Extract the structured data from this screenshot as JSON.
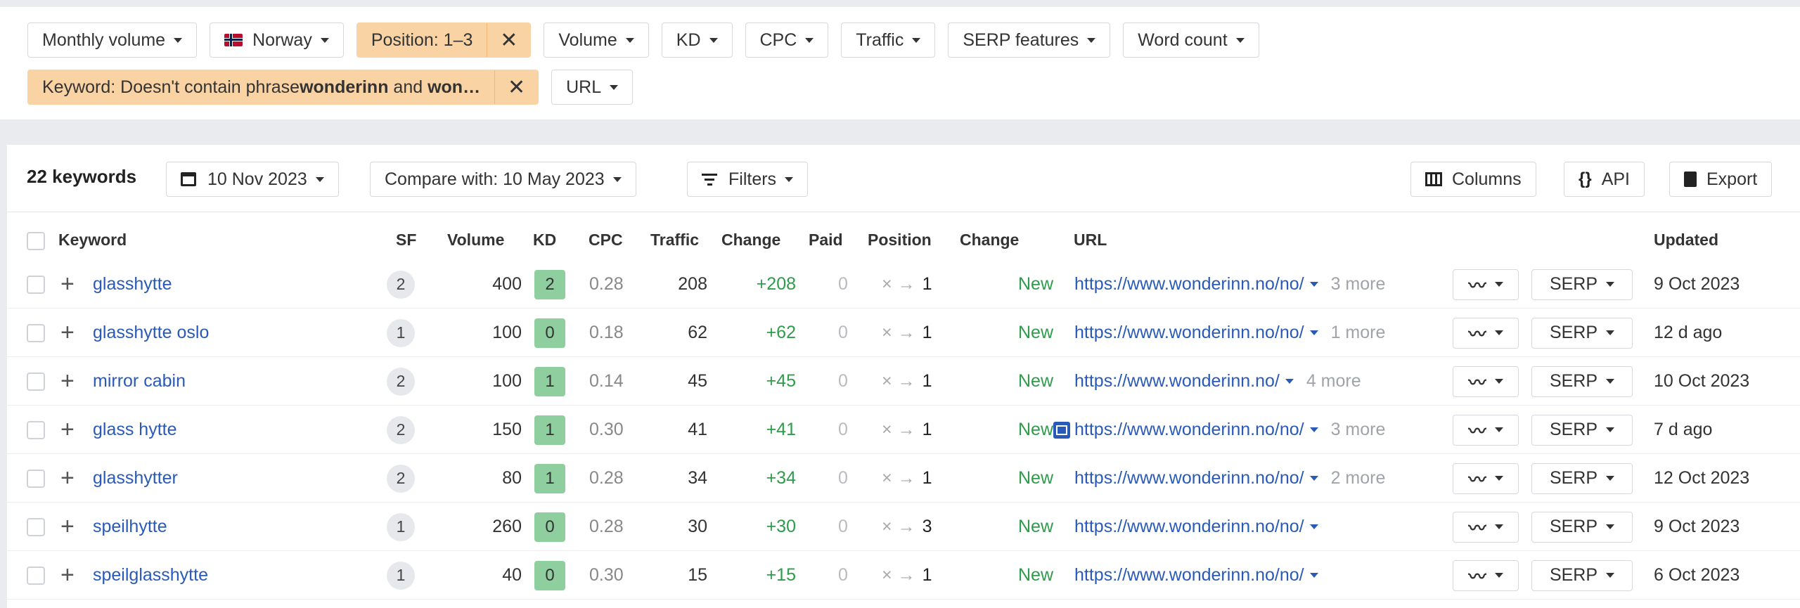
{
  "filters": {
    "row1": [
      {
        "label": "Monthly volume"
      },
      {
        "label": "Norway",
        "flag": "norway-flag"
      },
      {
        "label": "Position: 1–3",
        "active": true
      },
      {
        "label": "Volume"
      },
      {
        "label": "KD"
      },
      {
        "label": "CPC"
      },
      {
        "label": "Traffic"
      },
      {
        "label": "SERP features"
      },
      {
        "label": "Word count"
      }
    ],
    "keyword_filter": {
      "prefix": "Keyword: Doesn't contain phrase ",
      "bold1": "wonderinn",
      "mid": " and ",
      "bold2": "won…"
    },
    "url_label": "URL",
    "remove_glyph": "✕"
  },
  "toolbar": {
    "keyword_count": "22 keywords",
    "date": "10 Nov 2023",
    "compare": "Compare with: 10 May 2023",
    "filters": "Filters",
    "columns": "Columns",
    "api": "API",
    "api_icon": "{}",
    "export": "Export"
  },
  "columns": {
    "keyword": "Keyword",
    "sf": "SF",
    "volume": "Volume",
    "kd": "KD",
    "cpc": "CPC",
    "traffic": "Traffic",
    "change": "Change",
    "paid": "Paid",
    "position": "Position",
    "change2": "Change",
    "url": "URL",
    "updated": "Updated"
  },
  "rows": [
    {
      "keyword": "glasshytte",
      "sf": "2",
      "volume": "400",
      "kd": "2",
      "cpc": "0.28",
      "traffic": "208",
      "change": "+208",
      "paid": "0",
      "pos_from": "×",
      "pos_to": "1",
      "status": "New",
      "url": "https://www.wonderinn.no/no/",
      "more": "3 more",
      "updated": "9 Oct 2023"
    },
    {
      "keyword": "glasshytte oslo",
      "sf": "1",
      "volume": "100",
      "kd": "0",
      "cpc": "0.18",
      "traffic": "62",
      "change": "+62",
      "paid": "0",
      "pos_from": "×",
      "pos_to": "1",
      "status": "New",
      "url": "https://www.wonderinn.no/no/",
      "more": "1 more",
      "updated": "12 d ago"
    },
    {
      "keyword": "mirror cabin",
      "sf": "2",
      "volume": "100",
      "kd": "1",
      "cpc": "0.14",
      "traffic": "45",
      "change": "+45",
      "paid": "0",
      "pos_from": "×",
      "pos_to": "1",
      "status": "New",
      "url": "https://www.wonderinn.no/",
      "more": "4 more",
      "updated": "10 Oct 2023"
    },
    {
      "keyword": "glass hytte",
      "sf": "2",
      "volume": "150",
      "kd": "1",
      "cpc": "0.30",
      "traffic": "41",
      "change": "+41",
      "paid": "0",
      "pos_from": "×",
      "pos_to": "1",
      "status": "New",
      "url": "https://www.wonderinn.no/no/",
      "more": "3 more",
      "updated": "7 d ago",
      "image_icon": "image-icon"
    },
    {
      "keyword": "glasshytter",
      "sf": "2",
      "volume": "80",
      "kd": "1",
      "cpc": "0.28",
      "traffic": "34",
      "change": "+34",
      "paid": "0",
      "pos_from": "×",
      "pos_to": "1",
      "status": "New",
      "url": "https://www.wonderinn.no/no/",
      "more": "2 more",
      "updated": "12 Oct 2023"
    },
    {
      "keyword": "speilhytte",
      "sf": "1",
      "volume": "260",
      "kd": "0",
      "cpc": "0.28",
      "traffic": "30",
      "change": "+30",
      "paid": "0",
      "pos_from": "×",
      "pos_to": "3",
      "status": "New",
      "url": "https://www.wonderinn.no/no/",
      "more": "",
      "updated": "9 Oct 2023"
    },
    {
      "keyword": "speilglasshytte",
      "sf": "1",
      "volume": "40",
      "kd": "0",
      "cpc": "0.30",
      "traffic": "15",
      "change": "+15",
      "paid": "0",
      "pos_from": "×",
      "pos_to": "1",
      "status": "New",
      "url": "https://www.wonderinn.no/no/",
      "more": "",
      "updated": "6 Oct 2023"
    }
  ],
  "row_buttons": {
    "chart_glyph": "〰",
    "serp": "SERP"
  },
  "colors": {
    "link": "#2a5ab8",
    "positive": "#2e9c4b",
    "kd_badge": "#8fce9e",
    "active_filter": "#fad3a4"
  }
}
